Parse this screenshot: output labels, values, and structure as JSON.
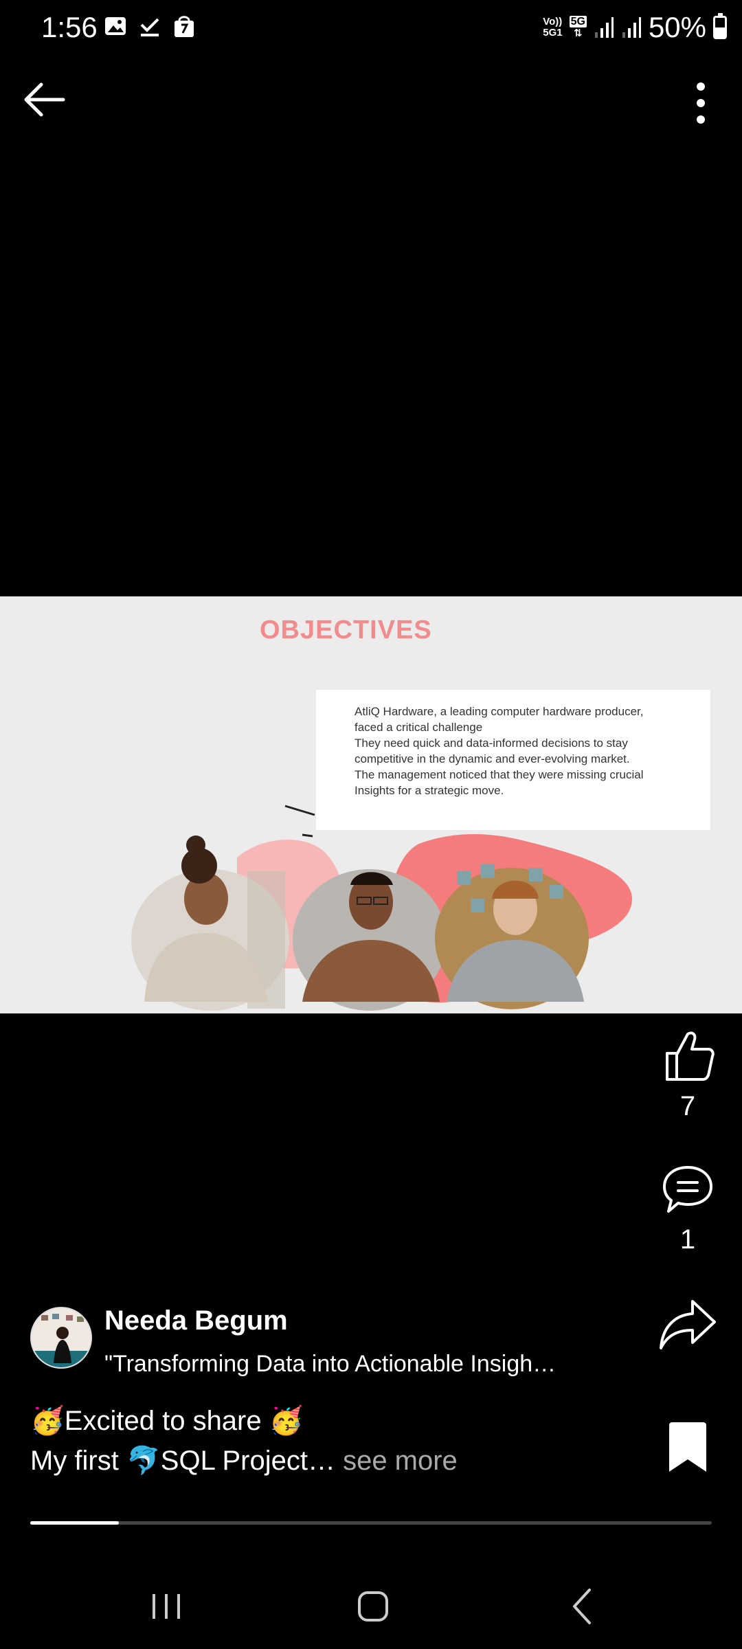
{
  "status_bar": {
    "time": "1:56",
    "battery_text": "50%",
    "battery_level": 0.5,
    "icons": [
      "gallery-icon",
      "download-done-icon",
      "shopping-bag-icon",
      "volte-icon",
      "5g-icon",
      "signal-icon",
      "signal-icon",
      "battery-icon"
    ],
    "network_label_top": "Vo))",
    "network_label_bottom": "5G1",
    "network_5g": "5G"
  },
  "slide": {
    "title": "OBJECTIVES",
    "box_line1": "AtliQ Hardware, a leading computer hardware producer,",
    "box_line2": "faced a critical challenge",
    "box_line3": "They need quick and data-informed decisions to stay",
    "box_line4": "competitive in the dynamic and ever-evolving market.",
    "box_line5": "The management noticed that they were missing crucial",
    "box_line6": "Insights for a strategic move."
  },
  "actions": {
    "like_count": "7",
    "comment_count": "1"
  },
  "post": {
    "author": "Needa Begum",
    "title": "\"Transforming Data into Actionable Insigh…",
    "caption_line1": "🥳Excited to share 🥳",
    "caption_line2": "My first 🐬SQL Project…",
    "see_more": " see more",
    "progress": 0.13
  },
  "colors": {
    "accent_pink": "#f28c8c",
    "background": "#000000",
    "slide_bg": "#ececec"
  }
}
